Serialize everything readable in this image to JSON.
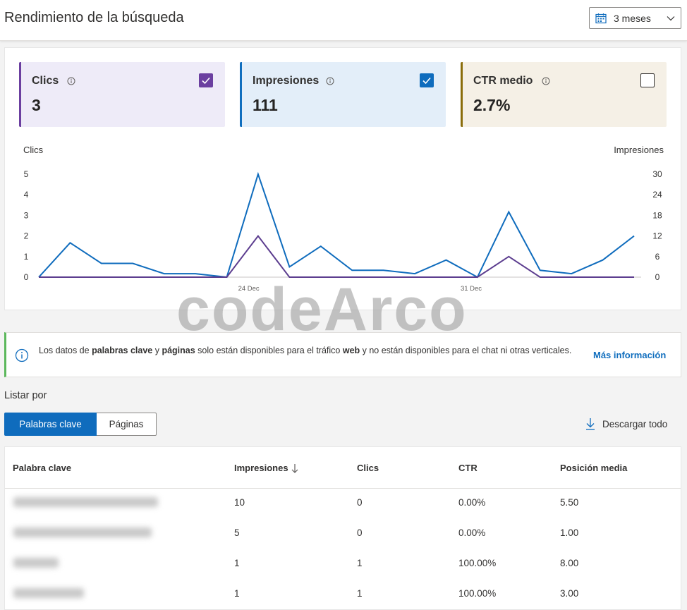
{
  "header": {
    "title": "Rendimiento de la búsqueda",
    "date_range": "3 meses"
  },
  "cards": [
    {
      "label": "Clics",
      "value": "3",
      "checked": true
    },
    {
      "label": "Impresiones",
      "value": "111",
      "checked": true
    },
    {
      "label": "CTR medio",
      "value": "2.7%",
      "checked": false
    }
  ],
  "chart_data": {
    "type": "line",
    "left_axis_label": "Clics",
    "right_axis_label": "Impresiones",
    "left_ticks": [
      "0",
      "1",
      "2",
      "3",
      "4",
      "5"
    ],
    "right_ticks": [
      "0",
      "6",
      "12",
      "18",
      "24",
      "30"
    ],
    "x_tick_labels": [
      "24 Dec",
      "31 Dec"
    ],
    "series": [
      {
        "name": "Impresiones",
        "axis": "right",
        "color": "#0f6cbd",
        "values": [
          0,
          10,
          4,
          4,
          1,
          1,
          0,
          30,
          3,
          9,
          2,
          2,
          1,
          5,
          0,
          19,
          2,
          1,
          5,
          12
        ]
      },
      {
        "name": "Clics",
        "axis": "left",
        "color": "#5c3d8f",
        "values": [
          0,
          0,
          0,
          0,
          0,
          0,
          0,
          2,
          0,
          0,
          0,
          0,
          0,
          0,
          0,
          1,
          0,
          0,
          0,
          0
        ]
      }
    ]
  },
  "notice": {
    "p1": "Los datos de ",
    "b1": "palabras clave",
    "p2": " y ",
    "b2": "páginas",
    "p3": " solo están disponibles para el tráfico ",
    "b3": "web",
    "p4": " y no están disponibles para el chat ni otras verticales.",
    "link": "Más información"
  },
  "list_by": {
    "label": "Listar por",
    "options": [
      "Palabras clave",
      "Páginas"
    ],
    "download": "Descargar todo"
  },
  "table": {
    "headers": [
      "Palabra clave",
      "Impresiones",
      "Clics",
      "CTR",
      "Posición media"
    ],
    "rows": [
      {
        "impressions": "10",
        "clicks": "0",
        "ctr": "0.00%",
        "position": "5.50"
      },
      {
        "impressions": "5",
        "clicks": "0",
        "ctr": "0.00%",
        "position": "1.00"
      },
      {
        "impressions": "1",
        "clicks": "1",
        "ctr": "100.00%",
        "position": "8.00"
      },
      {
        "impressions": "1",
        "clicks": "1",
        "ctr": "100.00%",
        "position": "3.00"
      }
    ]
  },
  "watermark": "codeArco"
}
